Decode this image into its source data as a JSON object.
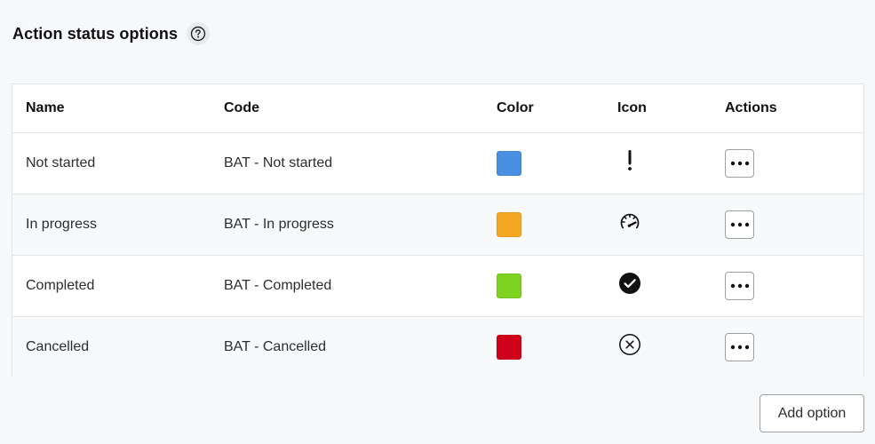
{
  "header": {
    "title": "Action status options"
  },
  "table": {
    "columns": {
      "name": "Name",
      "code": "Code",
      "color": "Color",
      "icon": "Icon",
      "actions": "Actions"
    },
    "rows": [
      {
        "name": "Not started",
        "code": "BAT - Not started",
        "color": "#4a90e2",
        "icon": "exclamation-icon"
      },
      {
        "name": "In progress",
        "code": "BAT - In progress",
        "color": "#f5a623",
        "icon": "speedometer-icon"
      },
      {
        "name": "Completed",
        "code": "BAT - Completed",
        "color": "#7ed321",
        "icon": "check-circle-icon"
      },
      {
        "name": "Cancelled",
        "code": "BAT - Cancelled",
        "color": "#d0021b",
        "icon": "close-circle-icon"
      }
    ]
  },
  "footer": {
    "add_label": "Add option"
  }
}
